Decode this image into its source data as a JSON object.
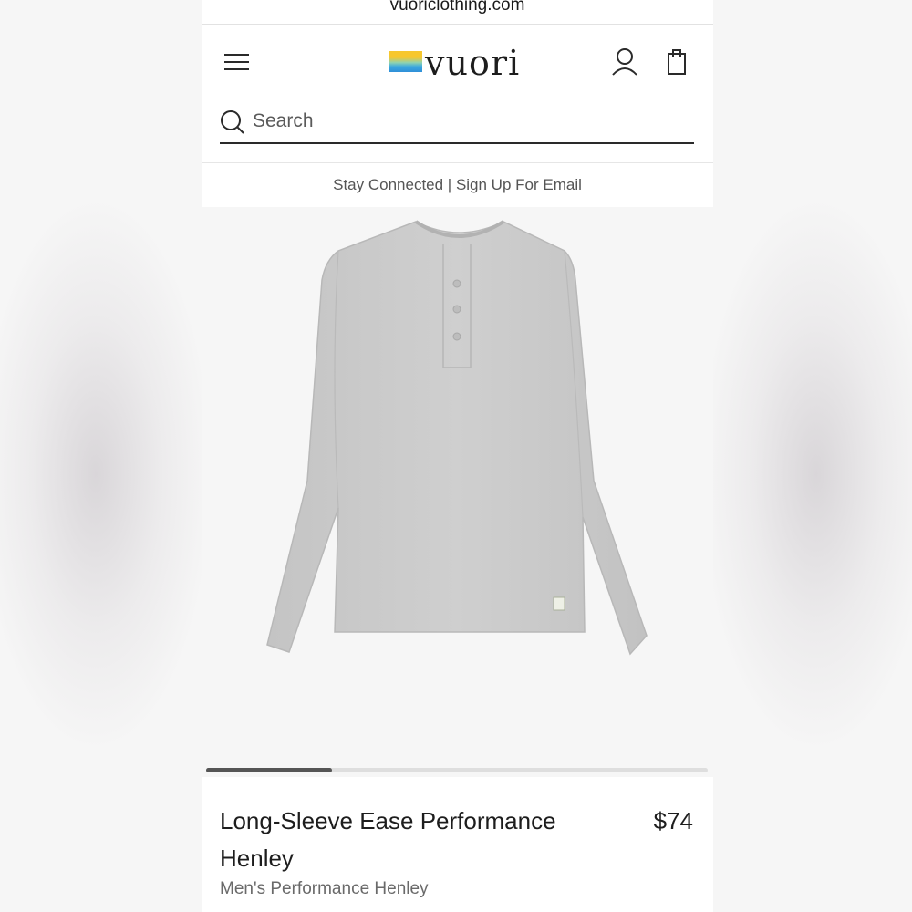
{
  "browser": {
    "url": "vuoriclothing.com"
  },
  "header": {
    "brand": "vuori",
    "menu_icon": "hamburger-menu-icon",
    "account_icon": "user-icon",
    "cart_icon": "shopping-bag-icon"
  },
  "search": {
    "placeholder": "Search",
    "icon": "search-icon"
  },
  "promo": {
    "text": "Stay Connected | Sign Up For Email"
  },
  "gallery": {
    "progress": 0.25
  },
  "product": {
    "title": "Long-Sleeve Ease Performance Henley",
    "price": "$74",
    "category": "Men's Performance Henley",
    "color": "#c9c9c9"
  },
  "colors": {
    "text": "#1d1d1d",
    "muted": "#6a6a6a",
    "logo_gradient": [
      "#f7c72e",
      "#8fd3b0",
      "#3aa7e0"
    ]
  }
}
